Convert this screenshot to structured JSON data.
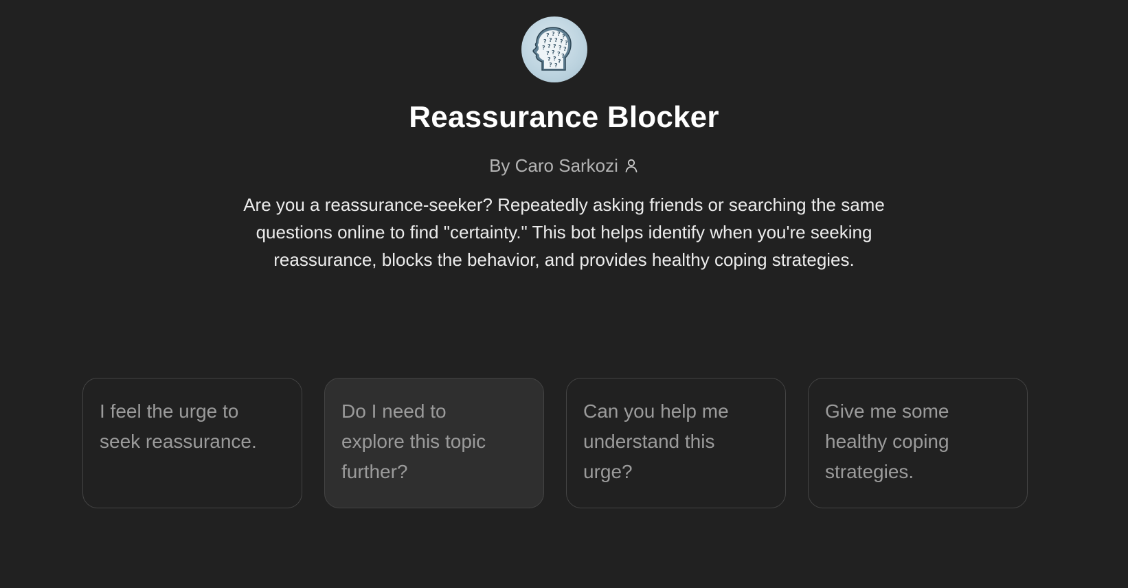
{
  "gpt": {
    "avatar_icon": "head-question-marks-icon",
    "title": "Reassurance Blocker",
    "byline": "By Caro Sarkozi",
    "description": "Are you a reassurance-seeker? Repeatedly asking friends or searching the same questions online to find \"certainty.\" This bot helps identify when you're seeking reassurance, blocks the behavior, and provides healthy coping strategies."
  },
  "starters": [
    {
      "label": "I feel the urge to seek reassurance."
    },
    {
      "label": "Do I need to explore this topic further?"
    },
    {
      "label": "Can you help me understand this urge?"
    },
    {
      "label": "Give me some healthy coping strategies."
    }
  ],
  "colors": {
    "background": "#212121",
    "title": "#ffffff",
    "byline": "#b4b4b4",
    "card_border": "#444444",
    "card_text": "#9b9b9b",
    "card_hover_bg": "#2f2f2f"
  }
}
